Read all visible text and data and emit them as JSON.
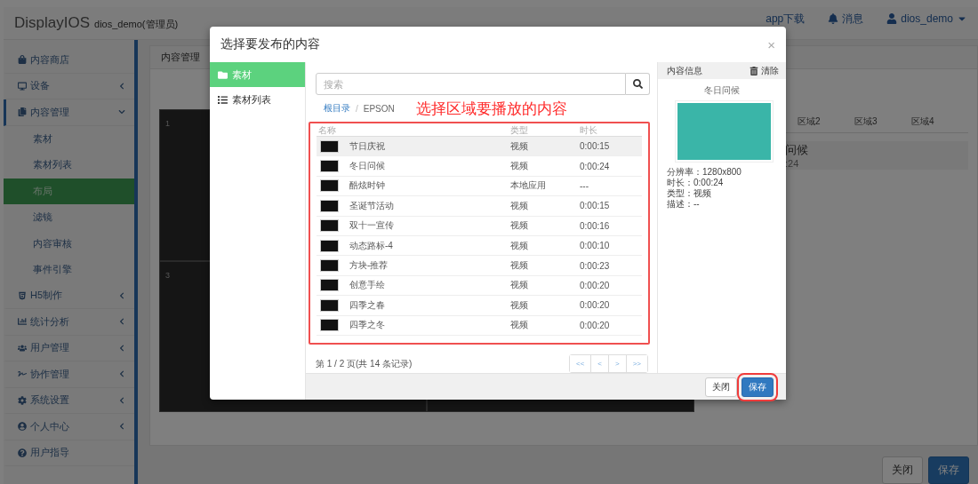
{
  "header": {
    "logo": "DisplayIOS",
    "account_label": "dios_demo(管理员)",
    "links": [
      {
        "kind": "plain",
        "label": "app下载"
      },
      {
        "kind": "bell",
        "label": "消息"
      },
      {
        "kind": "user",
        "label": "dios_demo"
      }
    ]
  },
  "sidebar": {
    "items": [
      {
        "label": "内容商店",
        "active": false
      },
      {
        "label": "设备",
        "expanded": false,
        "active": false
      },
      {
        "label": "内容管理",
        "expanded": true,
        "active": true,
        "children": [
          {
            "label": "素材",
            "selected": false
          },
          {
            "label": "素材列表",
            "selected": false
          },
          {
            "label": "布局",
            "selected": true
          },
          {
            "label": "滤镜",
            "selected": false
          },
          {
            "label": "内容审核",
            "selected": false
          },
          {
            "label": "事件引擎",
            "selected": false
          }
        ]
      },
      {
        "label": "H5制作",
        "expanded": false,
        "active": false
      },
      {
        "label": "统计分析",
        "expanded": false,
        "active": false
      },
      {
        "label": "用户管理",
        "expanded": false,
        "active": false
      },
      {
        "label": "协作管理",
        "expanded": false,
        "active": false
      },
      {
        "label": "系统设置",
        "expanded": false,
        "active": false
      },
      {
        "label": "个人中心",
        "expanded": false,
        "active": false
      },
      {
        "label": "用户指导",
        "active": false
      }
    ]
  },
  "main": {
    "breadcrumb": "内容管理",
    "canvas_regions": [
      "1",
      "3"
    ],
    "region_columns": [
      "区域2",
      "区域3",
      "区域4"
    ],
    "region_row": {
      "name": "问候",
      "duration": ":24"
    },
    "buttons": [
      {
        "label": "关闭",
        "kind": "default"
      },
      {
        "label": "保存",
        "kind": "primary"
      }
    ]
  },
  "modal": {
    "title": "选择要发布的内容",
    "close": "×",
    "nav": [
      {
        "label": "素材",
        "selected": true
      },
      {
        "label": "素材列表",
        "selected": false
      }
    ],
    "search": {
      "placeholder": "搜索"
    },
    "path": [
      {
        "label": "根目录",
        "kind": "link"
      },
      {
        "label": "/",
        "kind": "separator"
      },
      {
        "label": "EPSON",
        "kind": "current"
      }
    ],
    "annotation": "选择区域要播放的内容",
    "table": {
      "columns": [
        "名称",
        "类型",
        "时长"
      ],
      "rows": [
        {
          "name": "节日庆祝",
          "type": "视频",
          "duration": "0:00:15",
          "hovered": true
        },
        {
          "name": "冬日问候",
          "type": "视频",
          "duration": "0:00:24",
          "hovered": false
        },
        {
          "name": "酷炫时钟",
          "type": "本地应用",
          "duration": "---",
          "hovered": false
        },
        {
          "name": "圣诞节活动",
          "type": "视频",
          "duration": "0:00:15",
          "hovered": false
        },
        {
          "name": "双十一宣传",
          "type": "视频",
          "duration": "0:00:16",
          "hovered": false
        },
        {
          "name": "动态路标-4",
          "type": "视频",
          "duration": "0:00:10",
          "hovered": false
        },
        {
          "name": "方块-推荐",
          "type": "视频",
          "duration": "0:00:23",
          "hovered": false
        },
        {
          "name": "创意手绘",
          "type": "视频",
          "duration": "0:00:20",
          "hovered": false
        },
        {
          "name": "四季之春",
          "type": "视频",
          "duration": "0:00:20",
          "hovered": false
        },
        {
          "name": "四季之冬",
          "type": "视频",
          "duration": "0:00:20",
          "hovered": false
        }
      ]
    },
    "pagination": {
      "summary": "第 1 / 2 页(共 14 条记录)",
      "pages": [
        "<<",
        "<",
        ">",
        ">>"
      ]
    },
    "info": {
      "heading": "内容信息",
      "clear": "清除",
      "title": "冬日问候",
      "details": [
        "分辨率：1280x800",
        "时长：0:00:24",
        "类型：视频",
        "描述：--"
      ]
    },
    "footer": [
      {
        "label": "关闭",
        "kind": "default",
        "highlighted": false
      },
      {
        "label": "保存",
        "kind": "primary",
        "highlighted": true
      }
    ]
  }
}
